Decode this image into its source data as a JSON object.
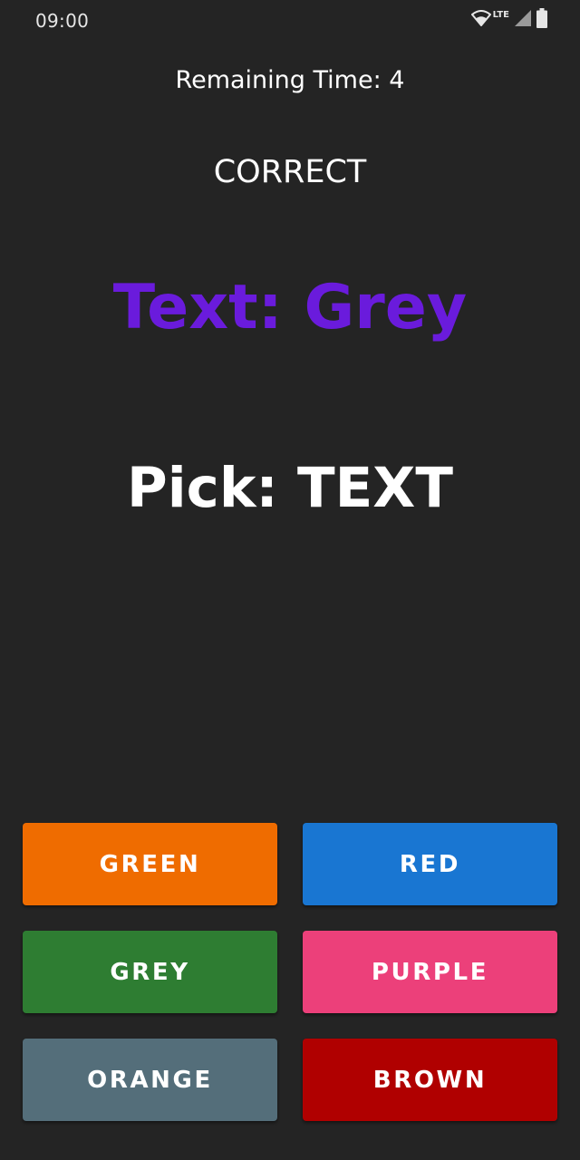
{
  "status_bar": {
    "time": "09:00",
    "network": "LTE",
    "icons": [
      "wifi-icon",
      "signal-icon",
      "battery-icon"
    ]
  },
  "game": {
    "remaining_time": "Remaining Time: 4",
    "feedback": "CORRECT",
    "prompt": "Text: Grey",
    "prompt_color": "#6a1bdc",
    "pick": "Pick: TEXT"
  },
  "buttons": [
    {
      "label": "GREEN",
      "color": "#ef6c00"
    },
    {
      "label": "RED",
      "color": "#1976d2"
    },
    {
      "label": "GREY",
      "color": "#2e7d32"
    },
    {
      "label": "PURPLE",
      "color": "#ec407a"
    },
    {
      "label": "ORANGE",
      "color": "#546e7a"
    },
    {
      "label": "BROWN",
      "color": "#b00000"
    }
  ]
}
